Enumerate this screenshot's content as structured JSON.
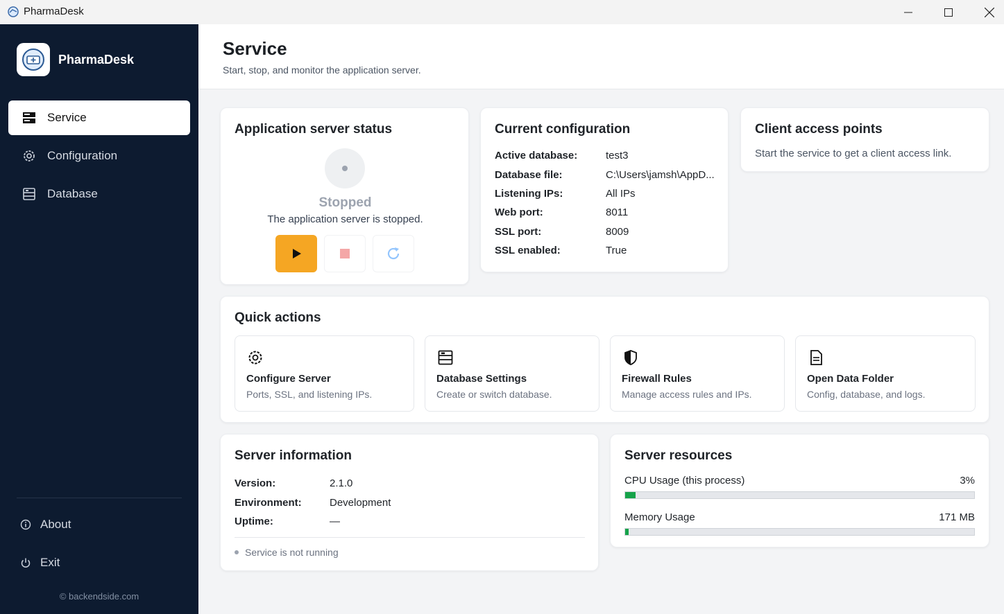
{
  "window": {
    "title": "PharmaDesk"
  },
  "sidebar": {
    "brand": "PharmaDesk",
    "items": [
      {
        "label": "Service",
        "icon": "server-icon",
        "active": true
      },
      {
        "label": "Configuration",
        "icon": "gear-icon",
        "active": false
      },
      {
        "label": "Database",
        "icon": "database-icon",
        "active": false
      }
    ],
    "about_label": "About",
    "exit_label": "Exit",
    "copyright": "© backendside.com"
  },
  "header": {
    "title": "Service",
    "subtitle": "Start, stop, and monitor the application server."
  },
  "status_card": {
    "title": "Application server status",
    "state": "Stopped",
    "description": "The application server is stopped."
  },
  "config_card": {
    "title": "Current configuration",
    "rows": [
      {
        "key": "Active database:",
        "value": "test3"
      },
      {
        "key": "Database file:",
        "value": "C:\\Users\\jamsh\\AppD..."
      },
      {
        "key": "Listening IPs:",
        "value": "All IPs"
      },
      {
        "key": "Web port:",
        "value": "8011"
      },
      {
        "key": "SSL port:",
        "value": "8009"
      },
      {
        "key": "SSL enabled:",
        "value": "True"
      }
    ]
  },
  "access_card": {
    "title": "Client access points",
    "description": "Start the service to get a client access link."
  },
  "quick_actions": {
    "title": "Quick actions",
    "items": [
      {
        "title": "Configure Server",
        "description": "Ports, SSL, and listening IPs.",
        "icon": "gear-icon"
      },
      {
        "title": "Database Settings",
        "description": "Create or switch database.",
        "icon": "database-icon"
      },
      {
        "title": "Firewall Rules",
        "description": "Manage access rules and IPs.",
        "icon": "shield-icon"
      },
      {
        "title": "Open Data Folder",
        "description": "Config, database, and logs.",
        "icon": "document-icon"
      }
    ]
  },
  "server_info": {
    "title": "Server information",
    "rows": [
      {
        "key": "Version:",
        "value": "2.1.0"
      },
      {
        "key": "Environment:",
        "value": "Development"
      },
      {
        "key": "Uptime:",
        "value": "—"
      }
    ],
    "status": "Service is not running"
  },
  "resources": {
    "title": "Server resources",
    "cpu": {
      "label": "CPU Usage (this process)",
      "value": "3%",
      "fraction": 0.03
    },
    "memory": {
      "label": "Memory Usage",
      "value": "171 MB",
      "fraction": 0.01
    }
  },
  "colors": {
    "sidebar_bg": "#0d1b30",
    "accent_start": "#f5a623",
    "stop_icon": "#f4a7a7",
    "restart_icon": "#93c5fd",
    "progress_fill": "#16a34a"
  }
}
